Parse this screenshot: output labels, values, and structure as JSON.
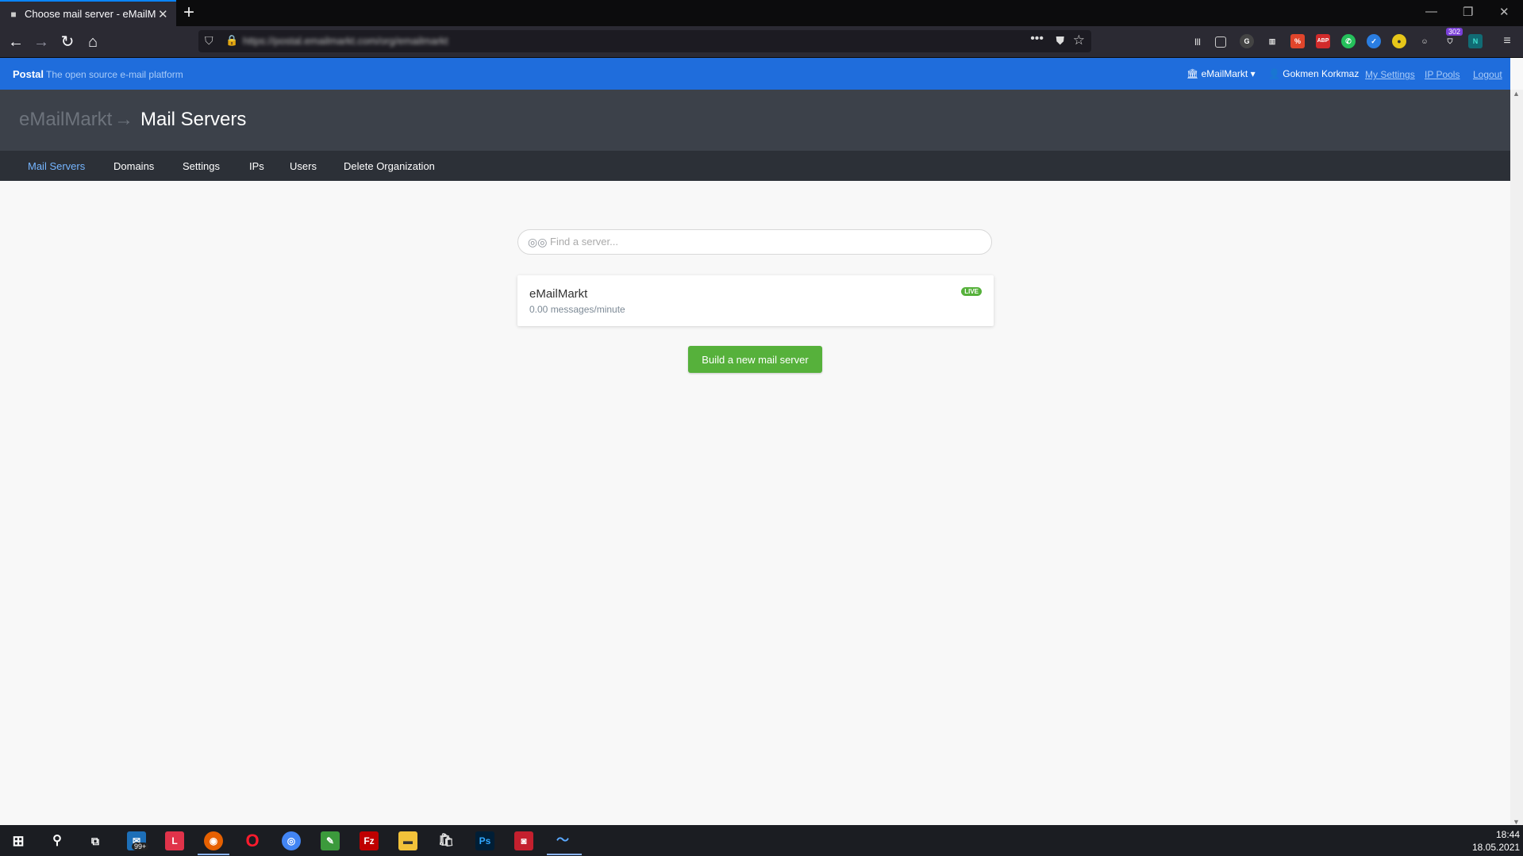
{
  "browser": {
    "tab_title": "Choose mail server - eMailMarkt",
    "url": "https://postal.emailmarkt.com/org/emailmarkt",
    "extensions_badge": "302"
  },
  "postal": {
    "brand": "Postal",
    "tagline": "The open source e-mail platform",
    "org_menu": "eMailMarkt",
    "user": "Gokmen Korkmaz",
    "links": [
      "My Settings",
      "IP Pools",
      "Logout"
    ]
  },
  "breadcrumb": {
    "org": "eMailMarkt",
    "arrow": "→",
    "page": "Mail Servers"
  },
  "subnav": [
    "Mail Servers",
    "Domains",
    "Settings",
    "IPs",
    "Users",
    "Delete Organization"
  ],
  "search": {
    "placeholder": "Find a server..."
  },
  "servers": [
    {
      "name": "eMailMarkt",
      "rate": "0.00 messages/minute",
      "badge": "LIVE"
    }
  ],
  "build_button": "Build a new mail server",
  "taskbar": {
    "mail_badge": "99+",
    "time": "18:44",
    "date": "18.05.2021"
  },
  "colors": {
    "primary": "#1f6ddc",
    "header_dark": "#3c414a",
    "subnav": "#2c3037",
    "success": "#56b13b",
    "active_link": "#75b5ff"
  }
}
